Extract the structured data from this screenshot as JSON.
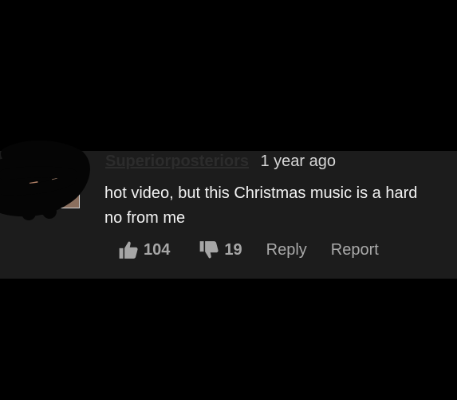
{
  "comment": {
    "username": "Superiorposteriors",
    "timestamp": "1 year ago",
    "text": "hot video, but this Christmas music is a hard no from me",
    "likes": "104",
    "dislikes": "19",
    "reply_label": "Reply",
    "report_label": "Report"
  },
  "icons": {
    "like": "thumbs-up-icon",
    "dislike": "thumbs-down-icon"
  },
  "colors": {
    "page_background": "#000000",
    "card_background": "#1c1c1c",
    "comment_text": "#f2f2f2",
    "action_text": "#a6a6a6"
  }
}
